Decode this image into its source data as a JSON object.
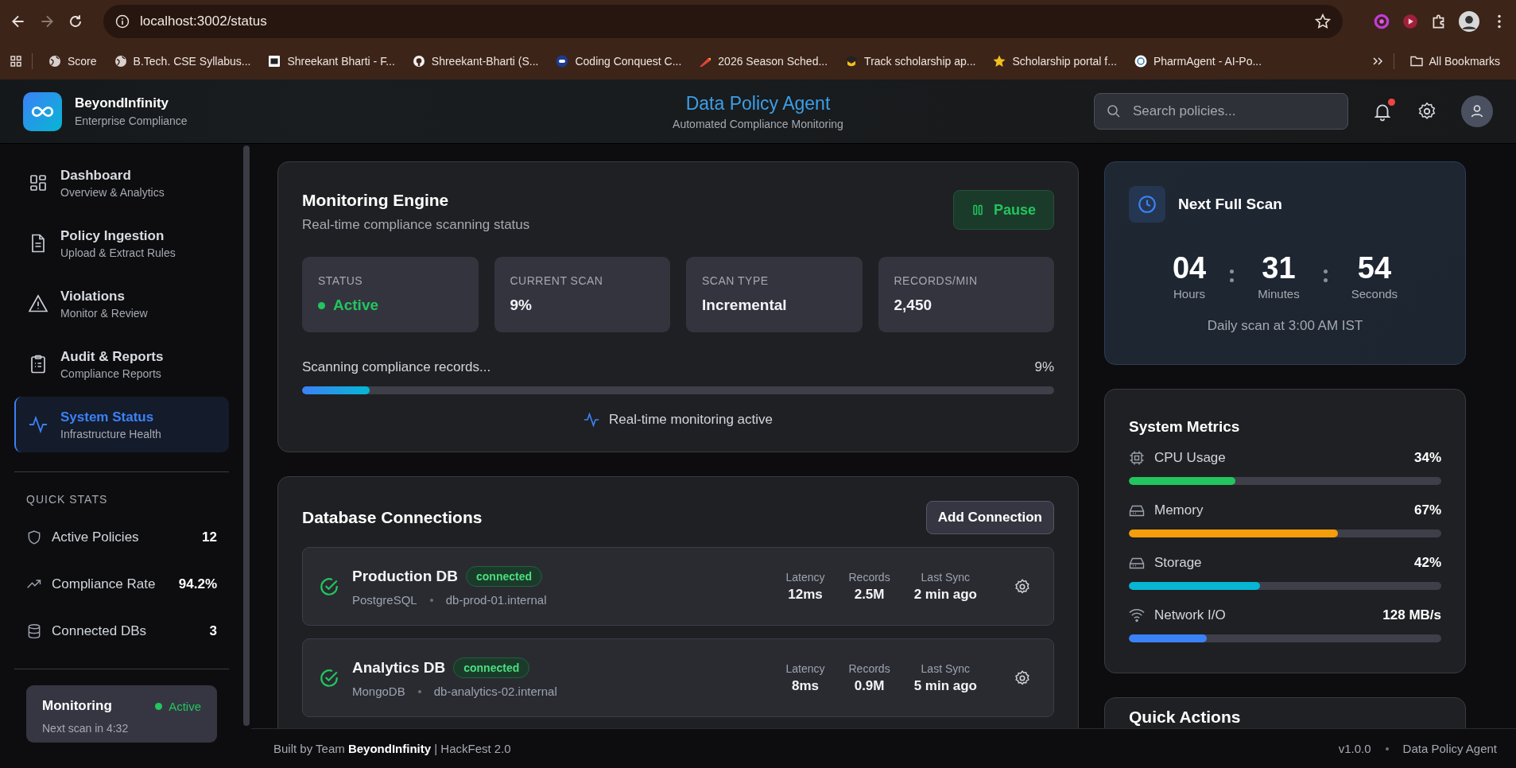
{
  "browser": {
    "url": "localhost:3002/status",
    "bookmarks": [
      {
        "label": "Score",
        "kind": "globe"
      },
      {
        "label": "B.Tech. CSE Syllabus...",
        "kind": "globe"
      },
      {
        "label": "Shreekant Bharti - F...",
        "kind": "square"
      },
      {
        "label": "Shreekant-Bharti (S...",
        "kind": "circle"
      },
      {
        "label": "Coding Conquest C...",
        "kind": "navy"
      },
      {
        "label": "2026 Season Sched...",
        "kind": "pencil"
      },
      {
        "label": "Track scholarship ap...",
        "kind": "cap"
      },
      {
        "label": "Scholarship portal f...",
        "kind": "star"
      },
      {
        "label": "PharmAgent - AI-Po...",
        "kind": "badge"
      }
    ],
    "all_bookmarks": "All Bookmarks"
  },
  "header": {
    "brand": "BeyondInfinity",
    "brand_subtitle": "Enterprise Compliance",
    "title": "Data Policy Agent",
    "subtitle": "Automated Compliance Monitoring",
    "search": {
      "placeholder": "Search policies..."
    },
    "unread_notifications": true
  },
  "sidebar": {
    "items": [
      {
        "title": "Dashboard",
        "subtitle": "Overview & Analytics",
        "selected": false
      },
      {
        "title": "Policy Ingestion",
        "subtitle": "Upload & Extract Rules",
        "selected": false
      },
      {
        "title": "Violations",
        "subtitle": "Monitor & Review",
        "selected": false
      },
      {
        "title": "Audit & Reports",
        "subtitle": "Compliance Reports",
        "selected": false
      },
      {
        "title": "System Status",
        "subtitle": "Infrastructure Health",
        "selected": true
      }
    ],
    "quick_stats_title": "QUICK STATS",
    "quick_stats": [
      {
        "label": "Active Policies",
        "value": "12"
      },
      {
        "label": "Compliance Rate",
        "value": "94.2%"
      },
      {
        "label": "Connected DBs",
        "value": "3"
      }
    ],
    "monitoring": {
      "title": "Monitoring",
      "status": "Active",
      "active": true,
      "next_scan": "Next scan in 4:32"
    }
  },
  "engine": {
    "title": "Monitoring Engine",
    "subtitle": "Real-time compliance scanning status",
    "pause_button": "Pause",
    "stats": [
      {
        "label": "STATUS",
        "value": "Active",
        "kind": "status"
      },
      {
        "label": "CURRENT SCAN",
        "value": "9%",
        "kind": "value"
      },
      {
        "label": "SCAN TYPE",
        "value": "Incremental",
        "kind": "value"
      },
      {
        "label": "RECORDS/MIN",
        "value": "2,450",
        "kind": "value"
      }
    ],
    "progress": {
      "label": "Scanning compliance records...",
      "reading": "9%",
      "level": 0.09
    },
    "live_note": "Real-time monitoring active"
  },
  "databases": {
    "title": "Database Connections",
    "add_button": "Add Connection",
    "items": [
      {
        "name": "Production DB",
        "status": "connected",
        "healthy": true,
        "engine": "PostgreSQL",
        "host": "db-prod-01.internal",
        "metrics": [
          {
            "label": "Latency",
            "value": "12ms"
          },
          {
            "label": "Records",
            "value": "2.5M"
          },
          {
            "label": "Last Sync",
            "value": "2 min ago"
          }
        ]
      },
      {
        "name": "Analytics DB",
        "status": "connected",
        "healthy": true,
        "engine": "MongoDB",
        "host": "db-analytics-02.internal",
        "metrics": [
          {
            "label": "Latency",
            "value": "8ms"
          },
          {
            "label": "Records",
            "value": "0.9M"
          },
          {
            "label": "Last Sync",
            "value": "5 min ago"
          }
        ]
      }
    ]
  },
  "next_scan": {
    "title": "Next Full Scan",
    "units": [
      {
        "value": "04",
        "label": "Hours"
      },
      {
        "value": "31",
        "label": "Minutes"
      },
      {
        "value": "54",
        "label": "Seconds"
      }
    ],
    "note": "Daily scan at 3:00 AM IST"
  },
  "metrics": {
    "title": "System Metrics",
    "items": [
      {
        "label": "CPU Usage",
        "value": "34%",
        "level": 0.34,
        "color": "#22c55e",
        "kind": "cpu"
      },
      {
        "label": "Memory",
        "value": "67%",
        "level": 0.67,
        "color": "#f59e0b",
        "kind": "drive"
      },
      {
        "label": "Storage",
        "value": "42%",
        "level": 0.42,
        "color": "#06b6d4",
        "kind": "drive"
      },
      {
        "label": "Network I/O",
        "value": "128 MB/s",
        "level": 0.25,
        "color": "#3b82f6",
        "kind": "network"
      }
    ]
  },
  "quick_actions": {
    "title": "Quick Actions"
  },
  "footer": {
    "credit": "Built by Team **BeyondInfinity** | HackFest 2.0",
    "version": "v1.0.0",
    "product": "Data Policy Agent"
  }
}
